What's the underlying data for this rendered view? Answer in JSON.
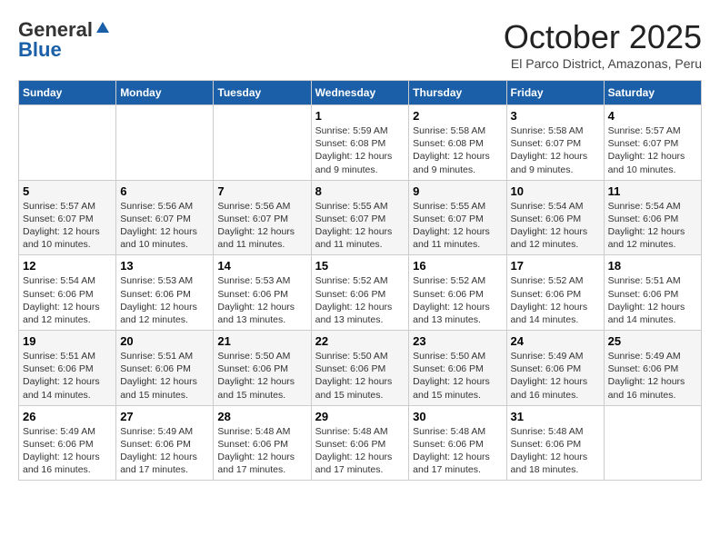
{
  "header": {
    "logo_general": "General",
    "logo_blue": "Blue",
    "month_title": "October 2025",
    "subtitle": "El Parco District, Amazonas, Peru"
  },
  "days_of_week": [
    "Sunday",
    "Monday",
    "Tuesday",
    "Wednesday",
    "Thursday",
    "Friday",
    "Saturday"
  ],
  "weeks": [
    [
      {
        "day": "",
        "info": ""
      },
      {
        "day": "",
        "info": ""
      },
      {
        "day": "",
        "info": ""
      },
      {
        "day": "1",
        "info": "Sunrise: 5:59 AM\nSunset: 6:08 PM\nDaylight: 12 hours and 9 minutes."
      },
      {
        "day": "2",
        "info": "Sunrise: 5:58 AM\nSunset: 6:08 PM\nDaylight: 12 hours and 9 minutes."
      },
      {
        "day": "3",
        "info": "Sunrise: 5:58 AM\nSunset: 6:07 PM\nDaylight: 12 hours and 9 minutes."
      },
      {
        "day": "4",
        "info": "Sunrise: 5:57 AM\nSunset: 6:07 PM\nDaylight: 12 hours and 10 minutes."
      }
    ],
    [
      {
        "day": "5",
        "info": "Sunrise: 5:57 AM\nSunset: 6:07 PM\nDaylight: 12 hours and 10 minutes."
      },
      {
        "day": "6",
        "info": "Sunrise: 5:56 AM\nSunset: 6:07 PM\nDaylight: 12 hours and 10 minutes."
      },
      {
        "day": "7",
        "info": "Sunrise: 5:56 AM\nSunset: 6:07 PM\nDaylight: 12 hours and 11 minutes."
      },
      {
        "day": "8",
        "info": "Sunrise: 5:55 AM\nSunset: 6:07 PM\nDaylight: 12 hours and 11 minutes."
      },
      {
        "day": "9",
        "info": "Sunrise: 5:55 AM\nSunset: 6:07 PM\nDaylight: 12 hours and 11 minutes."
      },
      {
        "day": "10",
        "info": "Sunrise: 5:54 AM\nSunset: 6:06 PM\nDaylight: 12 hours and 12 minutes."
      },
      {
        "day": "11",
        "info": "Sunrise: 5:54 AM\nSunset: 6:06 PM\nDaylight: 12 hours and 12 minutes."
      }
    ],
    [
      {
        "day": "12",
        "info": "Sunrise: 5:54 AM\nSunset: 6:06 PM\nDaylight: 12 hours and 12 minutes."
      },
      {
        "day": "13",
        "info": "Sunrise: 5:53 AM\nSunset: 6:06 PM\nDaylight: 12 hours and 12 minutes."
      },
      {
        "day": "14",
        "info": "Sunrise: 5:53 AM\nSunset: 6:06 PM\nDaylight: 12 hours and 13 minutes."
      },
      {
        "day": "15",
        "info": "Sunrise: 5:52 AM\nSunset: 6:06 PM\nDaylight: 12 hours and 13 minutes."
      },
      {
        "day": "16",
        "info": "Sunrise: 5:52 AM\nSunset: 6:06 PM\nDaylight: 12 hours and 13 minutes."
      },
      {
        "day": "17",
        "info": "Sunrise: 5:52 AM\nSunset: 6:06 PM\nDaylight: 12 hours and 14 minutes."
      },
      {
        "day": "18",
        "info": "Sunrise: 5:51 AM\nSunset: 6:06 PM\nDaylight: 12 hours and 14 minutes."
      }
    ],
    [
      {
        "day": "19",
        "info": "Sunrise: 5:51 AM\nSunset: 6:06 PM\nDaylight: 12 hours and 14 minutes."
      },
      {
        "day": "20",
        "info": "Sunrise: 5:51 AM\nSunset: 6:06 PM\nDaylight: 12 hours and 15 minutes."
      },
      {
        "day": "21",
        "info": "Sunrise: 5:50 AM\nSunset: 6:06 PM\nDaylight: 12 hours and 15 minutes."
      },
      {
        "day": "22",
        "info": "Sunrise: 5:50 AM\nSunset: 6:06 PM\nDaylight: 12 hours and 15 minutes."
      },
      {
        "day": "23",
        "info": "Sunrise: 5:50 AM\nSunset: 6:06 PM\nDaylight: 12 hours and 15 minutes."
      },
      {
        "day": "24",
        "info": "Sunrise: 5:49 AM\nSunset: 6:06 PM\nDaylight: 12 hours and 16 minutes."
      },
      {
        "day": "25",
        "info": "Sunrise: 5:49 AM\nSunset: 6:06 PM\nDaylight: 12 hours and 16 minutes."
      }
    ],
    [
      {
        "day": "26",
        "info": "Sunrise: 5:49 AM\nSunset: 6:06 PM\nDaylight: 12 hours and 16 minutes."
      },
      {
        "day": "27",
        "info": "Sunrise: 5:49 AM\nSunset: 6:06 PM\nDaylight: 12 hours and 17 minutes."
      },
      {
        "day": "28",
        "info": "Sunrise: 5:48 AM\nSunset: 6:06 PM\nDaylight: 12 hours and 17 minutes."
      },
      {
        "day": "29",
        "info": "Sunrise: 5:48 AM\nSunset: 6:06 PM\nDaylight: 12 hours and 17 minutes."
      },
      {
        "day": "30",
        "info": "Sunrise: 5:48 AM\nSunset: 6:06 PM\nDaylight: 12 hours and 17 minutes."
      },
      {
        "day": "31",
        "info": "Sunrise: 5:48 AM\nSunset: 6:06 PM\nDaylight: 12 hours and 18 minutes."
      },
      {
        "day": "",
        "info": ""
      }
    ]
  ]
}
